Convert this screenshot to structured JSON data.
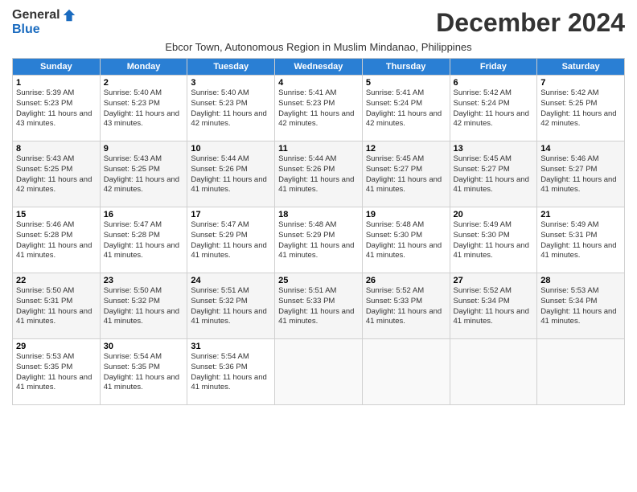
{
  "header": {
    "logo_general": "General",
    "logo_blue": "Blue",
    "month_title": "December 2024",
    "subtitle": "Ebcor Town, Autonomous Region in Muslim Mindanao, Philippines"
  },
  "days_of_week": [
    "Sunday",
    "Monday",
    "Tuesday",
    "Wednesday",
    "Thursday",
    "Friday",
    "Saturday"
  ],
  "weeks": [
    [
      {
        "day": "1",
        "sunrise": "5:39 AM",
        "sunset": "5:23 PM",
        "daylight": "11 hours and 43 minutes."
      },
      {
        "day": "2",
        "sunrise": "5:40 AM",
        "sunset": "5:23 PM",
        "daylight": "11 hours and 43 minutes."
      },
      {
        "day": "3",
        "sunrise": "5:40 AM",
        "sunset": "5:23 PM",
        "daylight": "11 hours and 42 minutes."
      },
      {
        "day": "4",
        "sunrise": "5:41 AM",
        "sunset": "5:23 PM",
        "daylight": "11 hours and 42 minutes."
      },
      {
        "day": "5",
        "sunrise": "5:41 AM",
        "sunset": "5:24 PM",
        "daylight": "11 hours and 42 minutes."
      },
      {
        "day": "6",
        "sunrise": "5:42 AM",
        "sunset": "5:24 PM",
        "daylight": "11 hours and 42 minutes."
      },
      {
        "day": "7",
        "sunrise": "5:42 AM",
        "sunset": "5:25 PM",
        "daylight": "11 hours and 42 minutes."
      }
    ],
    [
      {
        "day": "8",
        "sunrise": "5:43 AM",
        "sunset": "5:25 PM",
        "daylight": "11 hours and 42 minutes."
      },
      {
        "day": "9",
        "sunrise": "5:43 AM",
        "sunset": "5:25 PM",
        "daylight": "11 hours and 42 minutes."
      },
      {
        "day": "10",
        "sunrise": "5:44 AM",
        "sunset": "5:26 PM",
        "daylight": "11 hours and 41 minutes."
      },
      {
        "day": "11",
        "sunrise": "5:44 AM",
        "sunset": "5:26 PM",
        "daylight": "11 hours and 41 minutes."
      },
      {
        "day": "12",
        "sunrise": "5:45 AM",
        "sunset": "5:27 PM",
        "daylight": "11 hours and 41 minutes."
      },
      {
        "day": "13",
        "sunrise": "5:45 AM",
        "sunset": "5:27 PM",
        "daylight": "11 hours and 41 minutes."
      },
      {
        "day": "14",
        "sunrise": "5:46 AM",
        "sunset": "5:27 PM",
        "daylight": "11 hours and 41 minutes."
      }
    ],
    [
      {
        "day": "15",
        "sunrise": "5:46 AM",
        "sunset": "5:28 PM",
        "daylight": "11 hours and 41 minutes."
      },
      {
        "day": "16",
        "sunrise": "5:47 AM",
        "sunset": "5:28 PM",
        "daylight": "11 hours and 41 minutes."
      },
      {
        "day": "17",
        "sunrise": "5:47 AM",
        "sunset": "5:29 PM",
        "daylight": "11 hours and 41 minutes."
      },
      {
        "day": "18",
        "sunrise": "5:48 AM",
        "sunset": "5:29 PM",
        "daylight": "11 hours and 41 minutes."
      },
      {
        "day": "19",
        "sunrise": "5:48 AM",
        "sunset": "5:30 PM",
        "daylight": "11 hours and 41 minutes."
      },
      {
        "day": "20",
        "sunrise": "5:49 AM",
        "sunset": "5:30 PM",
        "daylight": "11 hours and 41 minutes."
      },
      {
        "day": "21",
        "sunrise": "5:49 AM",
        "sunset": "5:31 PM",
        "daylight": "11 hours and 41 minutes."
      }
    ],
    [
      {
        "day": "22",
        "sunrise": "5:50 AM",
        "sunset": "5:31 PM",
        "daylight": "11 hours and 41 minutes."
      },
      {
        "day": "23",
        "sunrise": "5:50 AM",
        "sunset": "5:32 PM",
        "daylight": "11 hours and 41 minutes."
      },
      {
        "day": "24",
        "sunrise": "5:51 AM",
        "sunset": "5:32 PM",
        "daylight": "11 hours and 41 minutes."
      },
      {
        "day": "25",
        "sunrise": "5:51 AM",
        "sunset": "5:33 PM",
        "daylight": "11 hours and 41 minutes."
      },
      {
        "day": "26",
        "sunrise": "5:52 AM",
        "sunset": "5:33 PM",
        "daylight": "11 hours and 41 minutes."
      },
      {
        "day": "27",
        "sunrise": "5:52 AM",
        "sunset": "5:34 PM",
        "daylight": "11 hours and 41 minutes."
      },
      {
        "day": "28",
        "sunrise": "5:53 AM",
        "sunset": "5:34 PM",
        "daylight": "11 hours and 41 minutes."
      }
    ],
    [
      {
        "day": "29",
        "sunrise": "5:53 AM",
        "sunset": "5:35 PM",
        "daylight": "11 hours and 41 minutes."
      },
      {
        "day": "30",
        "sunrise": "5:54 AM",
        "sunset": "5:35 PM",
        "daylight": "11 hours and 41 minutes."
      },
      {
        "day": "31",
        "sunrise": "5:54 AM",
        "sunset": "5:36 PM",
        "daylight": "11 hours and 41 minutes."
      },
      null,
      null,
      null,
      null
    ]
  ]
}
